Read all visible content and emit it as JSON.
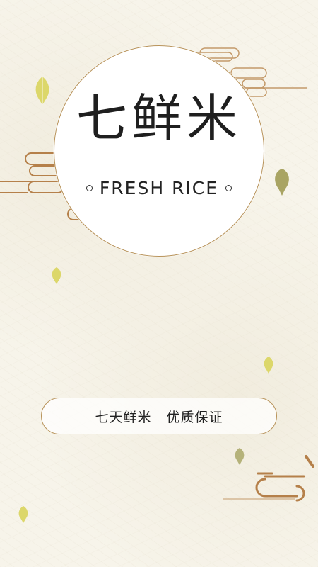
{
  "splash": {
    "logo_title": "七鲜米",
    "logo_subtitle": "FRESH  RICE",
    "slogan": "七天鲜米   优质保证"
  },
  "colors": {
    "background": "#f7f4ea",
    "gold_line": "#b8935a",
    "cloud_copper": "#b5804a",
    "leaf_yellow": "#dcd76a",
    "leaf_olive": "#a9a463",
    "text": "#222222"
  },
  "icons": [
    "cloud-pattern",
    "rice-drop",
    "ring"
  ]
}
